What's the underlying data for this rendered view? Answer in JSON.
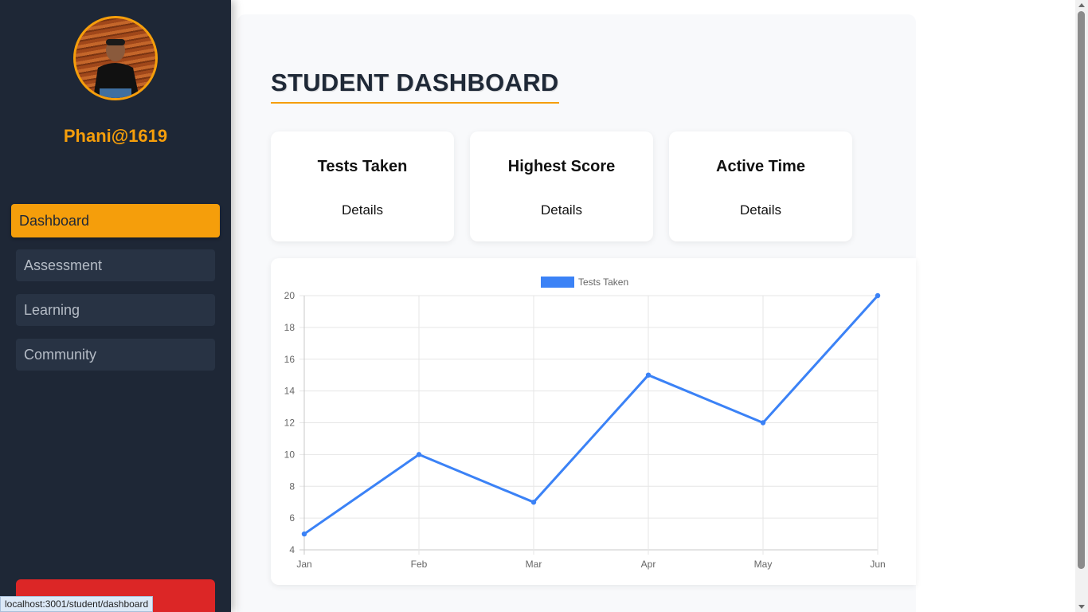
{
  "sidebar": {
    "username": "Phani@1619",
    "nav": [
      {
        "label": "Dashboard",
        "active": true
      },
      {
        "label": "Assessment",
        "active": false
      },
      {
        "label": "Learning",
        "active": false
      },
      {
        "label": "Community",
        "active": false
      }
    ]
  },
  "main": {
    "title": "STUDENT DASHBOARD",
    "cards": [
      {
        "title": "Tests Taken",
        "detail": "Details"
      },
      {
        "title": "Highest Score",
        "detail": "Details"
      },
      {
        "title": "Active Time",
        "detail": "Details"
      }
    ]
  },
  "chart_data": {
    "type": "line",
    "categories": [
      "Jan",
      "Feb",
      "Mar",
      "Apr",
      "May",
      "Jun"
    ],
    "series": [
      {
        "name": "Tests Taken",
        "values": [
          5,
          10,
          7,
          15,
          12,
          20
        ],
        "color": "#3b82f6"
      }
    ],
    "ylim": [
      4,
      20
    ],
    "yticks": [
      4,
      6,
      8,
      10,
      12,
      14,
      16,
      18,
      20
    ],
    "grid": true,
    "legend": "top"
  },
  "status_bar": {
    "url": "localhost:3001/student/dashboard"
  },
  "colors": {
    "accent": "#f59e0b",
    "sidebar": "#1e2736",
    "logout": "#dc2626",
    "series": "#3b82f6"
  }
}
